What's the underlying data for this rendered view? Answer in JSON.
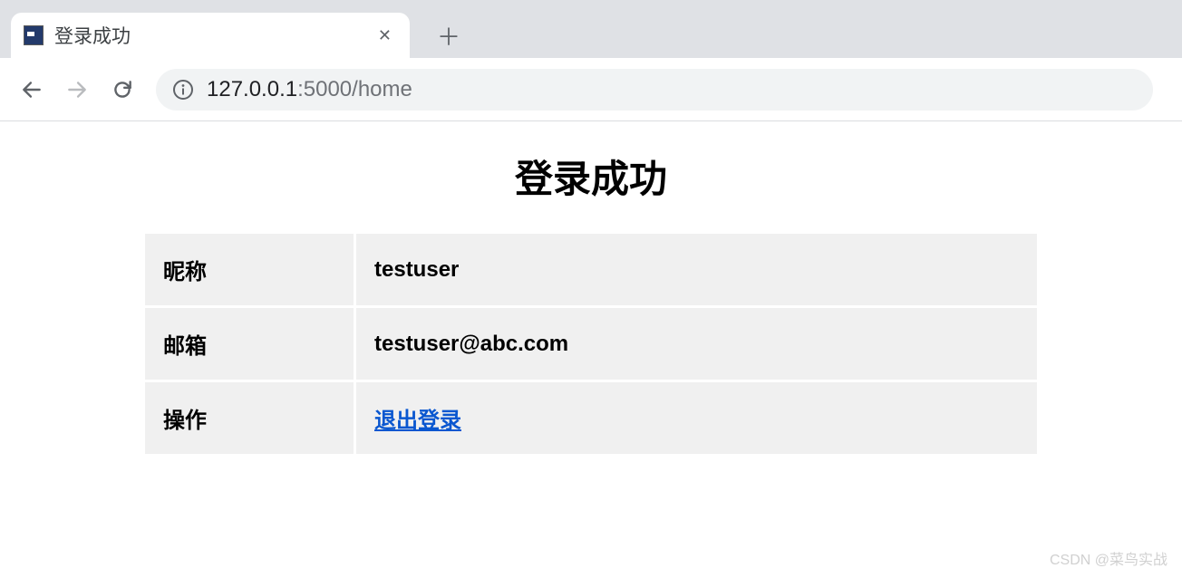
{
  "browser": {
    "tab_title": "登录成功",
    "close_glyph": "✕",
    "new_tab_glyph": "＋",
    "url_host": "127.0.0.1",
    "url_port": ":5000",
    "url_path": "/home"
  },
  "page": {
    "heading": "登录成功",
    "rows": {
      "nickname_label": "昵称",
      "nickname_value": "testuser",
      "email_label": "邮箱",
      "email_value": "testuser@abc.com",
      "action_label": "操作",
      "logout_text": "退出登录"
    }
  },
  "watermark": "CSDN @菜鸟实战"
}
